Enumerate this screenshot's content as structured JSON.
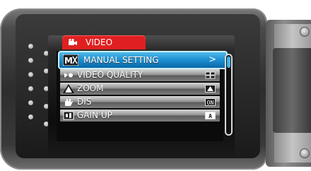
{
  "header": {
    "tab_label": "VIDEO",
    "tab_icon": "video-camera-icon"
  },
  "menu": {
    "items": [
      {
        "label": "MANUAL SETTING",
        "icon": "manual-setting-icon",
        "value": ">",
        "selected": true
      },
      {
        "label": "VIDEO QUALITY",
        "icon": "video-quality-icon",
        "value": "",
        "selected": false
      },
      {
        "label": "ZOOM",
        "icon": "zoom-icon",
        "value": "",
        "selected": false
      },
      {
        "label": "DIS",
        "icon": "dis-icon",
        "value": "ON",
        "selected": false
      },
      {
        "label": "GAIN UP",
        "icon": "gain-up-icon",
        "value": "A",
        "selected": false
      }
    ]
  },
  "scrollbar": {
    "position": 0
  },
  "colors": {
    "tab": "#e02020",
    "selected": "#1b8fd0",
    "scroll_thumb": "#3fb4ec"
  }
}
